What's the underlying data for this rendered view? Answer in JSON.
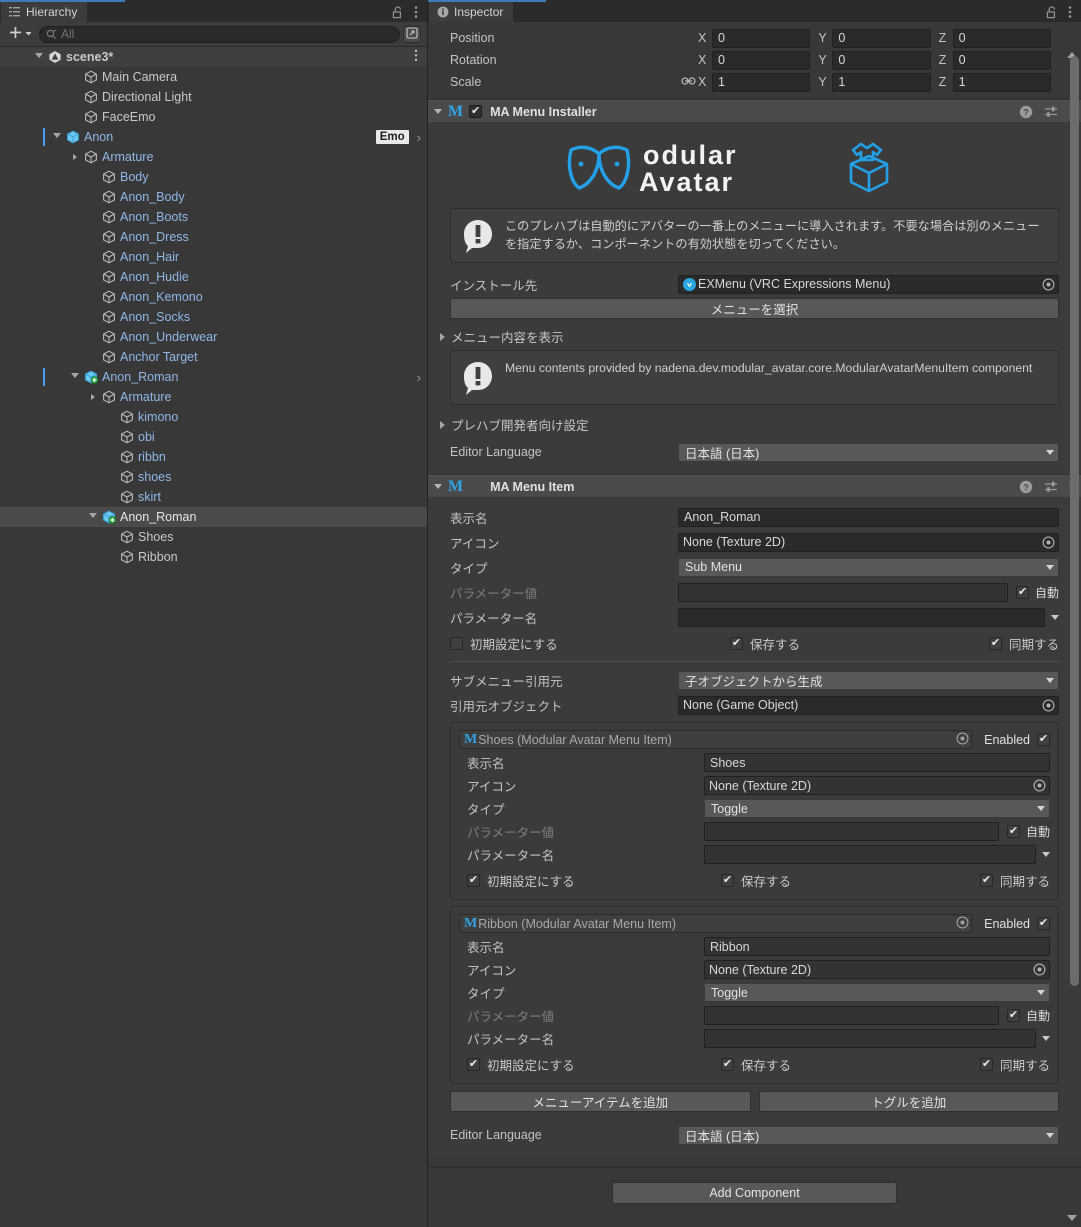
{
  "hierarchy": {
    "tab_label": "Hierarchy",
    "tab_icon": "hierarchy-icon",
    "lock_icon": "lock-open-icon",
    "menu_icon": "kebab-menu-icon",
    "create_label": "+",
    "search": {
      "placeholder": "All",
      "value": "",
      "icon": "search-icon"
    },
    "sort_icon": "sort-icon",
    "items": [
      {
        "label": "scene3*",
        "depth": 0,
        "icon": "unity-scene-icon",
        "twisty": "open",
        "selected": false,
        "style": "scene",
        "kebab": true
      },
      {
        "label": "Main Camera",
        "depth": 2,
        "icon": "gameobject-cube-icon",
        "twisty": "none",
        "selected": false,
        "style": "grey"
      },
      {
        "label": "Directional Light",
        "depth": 2,
        "icon": "gameobject-cube-icon",
        "twisty": "none",
        "selected": false,
        "style": "grey"
      },
      {
        "label": "FaceEmo",
        "depth": 2,
        "icon": "gameobject-cube-icon",
        "twisty": "none",
        "selected": false,
        "style": "grey"
      },
      {
        "label": "Anon",
        "depth": 1,
        "icon": "prefab-cube-icon",
        "twisty": "open",
        "selected": false,
        "style": "blue",
        "bar": true,
        "badge": "Emo",
        "chevron": true
      },
      {
        "label": "Armature",
        "depth": 2,
        "icon": "gameobject-cube-icon",
        "twisty": "closed",
        "selected": false,
        "style": "blue"
      },
      {
        "label": "Body",
        "depth": 3,
        "icon": "gameobject-cube-icon",
        "twisty": "none",
        "selected": false,
        "style": "blue"
      },
      {
        "label": "Anon_Body",
        "depth": 3,
        "icon": "gameobject-cube-icon",
        "twisty": "none",
        "selected": false,
        "style": "blue"
      },
      {
        "label": "Anon_Boots",
        "depth": 3,
        "icon": "gameobject-cube-icon",
        "twisty": "none",
        "selected": false,
        "style": "blue"
      },
      {
        "label": "Anon_Dress",
        "depth": 3,
        "icon": "gameobject-cube-icon",
        "twisty": "none",
        "selected": false,
        "style": "blue"
      },
      {
        "label": "Anon_Hair",
        "depth": 3,
        "icon": "gameobject-cube-icon",
        "twisty": "none",
        "selected": false,
        "style": "blue"
      },
      {
        "label": "Anon_Hudie",
        "depth": 3,
        "icon": "gameobject-cube-icon",
        "twisty": "none",
        "selected": false,
        "style": "blue"
      },
      {
        "label": "Anon_Kemono",
        "depth": 3,
        "icon": "gameobject-cube-icon",
        "twisty": "none",
        "selected": false,
        "style": "blue"
      },
      {
        "label": "Anon_Socks",
        "depth": 3,
        "icon": "gameobject-cube-icon",
        "twisty": "none",
        "selected": false,
        "style": "blue"
      },
      {
        "label": "Anon_Underwear",
        "depth": 3,
        "icon": "gameobject-cube-icon",
        "twisty": "none",
        "selected": false,
        "style": "blue"
      },
      {
        "label": "Anchor Target",
        "depth": 3,
        "icon": "gameobject-cube-icon",
        "twisty": "none",
        "selected": false,
        "style": "blue"
      },
      {
        "label": "Anon_Roman",
        "depth": 2,
        "icon": "prefab-variant-icon",
        "twisty": "open",
        "selected": false,
        "style": "blue",
        "bar": true,
        "chevron": true
      },
      {
        "label": "Armature",
        "depth": 3,
        "icon": "gameobject-cube-icon",
        "twisty": "closed",
        "selected": false,
        "style": "blue"
      },
      {
        "label": "kimono",
        "depth": 4,
        "icon": "gameobject-cube-icon",
        "twisty": "none",
        "selected": false,
        "style": "blue"
      },
      {
        "label": "obi",
        "depth": 4,
        "icon": "gameobject-cube-icon",
        "twisty": "none",
        "selected": false,
        "style": "blue"
      },
      {
        "label": "ribbn",
        "depth": 4,
        "icon": "gameobject-cube-icon",
        "twisty": "none",
        "selected": false,
        "style": "blue"
      },
      {
        "label": "shoes",
        "depth": 4,
        "icon": "gameobject-cube-icon",
        "twisty": "none",
        "selected": false,
        "style": "blue"
      },
      {
        "label": "skirt",
        "depth": 4,
        "icon": "gameobject-cube-icon",
        "twisty": "none",
        "selected": false,
        "style": "blue"
      },
      {
        "label": "Anon_Roman",
        "depth": 3,
        "icon": "prefab-variant-icon",
        "twisty": "open",
        "selected": true,
        "style": "white"
      },
      {
        "label": "Shoes",
        "depth": 4,
        "icon": "gameobject-cube-icon",
        "twisty": "none",
        "selected": false,
        "style": "grey"
      },
      {
        "label": "Ribbon",
        "depth": 4,
        "icon": "gameobject-cube-icon",
        "twisty": "none",
        "selected": false,
        "style": "grey"
      }
    ]
  },
  "inspector": {
    "tab_label": "Inspector",
    "tab_icon": "info-icon",
    "lock_icon": "lock-open-icon",
    "menu_icon": "kebab-menu-icon",
    "transform": {
      "rows": [
        {
          "label": "Position",
          "link": false,
          "x": "0",
          "y": "0",
          "z": "0"
        },
        {
          "label": "Rotation",
          "link": false,
          "x": "0",
          "y": "0",
          "z": "0"
        },
        {
          "label": "Scale",
          "link": true,
          "x": "1",
          "y": "1",
          "z": "1"
        }
      ],
      "axis_x": "X",
      "axis_y": "Y",
      "axis_z": "Z",
      "link_icon": "constrain-proportions-icon"
    },
    "installer": {
      "title": "MA Menu Installer",
      "enabled": true,
      "logo_alt": "Modular Avatar",
      "logo_line1": "odular",
      "logo_line2": "Avatar",
      "help_text": "このプレハブは自動的にアバターの一番上のメニューに導入されます。不要な場合は別のメニューを指定するか、コンポーネントの有効状態を切ってください。",
      "install_target_label": "インストール先",
      "install_target_value": "EXMenu (VRC Expressions Menu)",
      "select_menu_button": "メニューを選択",
      "show_menu_contents_label": "メニュー内容を表示",
      "info_text": "Menu contents provided by nadena.dev.modular_avatar.core.ModularAvatarMenuItem component",
      "prefab_dev_label": "プレハブ開発者向け設定",
      "editor_language_label": "Editor Language",
      "editor_language_value": "日本語 (日本)",
      "help_icon": "help-icon",
      "preset_icon": "preset-icon",
      "kebab_icon": "kebab-menu-icon"
    },
    "menu_item": {
      "title": "MA Menu Item",
      "display_name_label": "表示名",
      "display_name_value": "Anon_Roman",
      "icon_label": "アイコン",
      "icon_value": "None (Texture 2D)",
      "type_label": "タイプ",
      "type_value": "Sub Menu",
      "param_value_label": "パラメーター値",
      "param_value": "",
      "auto_label": "自動",
      "auto_checked": true,
      "param_name_label": "パラメーター名",
      "param_name_value": "",
      "default_label": "初期設定にする",
      "default_checked": false,
      "saved_label": "保存する",
      "saved_checked": true,
      "synced_label": "同期する",
      "synced_checked": true,
      "submenu_source_label": "サブメニュー引用元",
      "submenu_source_value": "子オブジェクトから生成",
      "source_object_label": "引用元オブジェクト",
      "source_object_value": "None (Game Object)",
      "enabled_label": "Enabled",
      "add_menu_item_button": "メニューアイテムを追加",
      "add_toggle_button": "トグルを追加",
      "editor_language_label": "Editor Language",
      "editor_language_value": "日本語 (日本)",
      "children": [
        {
          "object_value": "Shoes (Modular Avatar Menu Item)",
          "enabled": true,
          "display_name_value": "Shoes",
          "icon_value": "None (Texture 2D)",
          "type_value": "Toggle",
          "param_value": "",
          "auto_checked": true,
          "param_name_value": "",
          "default_checked": true,
          "saved_checked": true,
          "synced_checked": true
        },
        {
          "object_value": "Ribbon (Modular Avatar Menu Item)",
          "enabled": true,
          "display_name_value": "Ribbon",
          "icon_value": "None (Texture 2D)",
          "type_value": "Toggle",
          "param_value": "",
          "auto_checked": true,
          "param_name_value": "",
          "default_checked": true,
          "saved_checked": true,
          "synced_checked": true
        }
      ]
    },
    "add_component_button": "Add Component"
  },
  "colors": {
    "accent_blue": "#2fa5e8",
    "tab_accent": "#3d7ab8",
    "prefab_blue": "#8fb8e8",
    "panel_bg": "#383838",
    "header_bg": "#4a4a4a"
  }
}
